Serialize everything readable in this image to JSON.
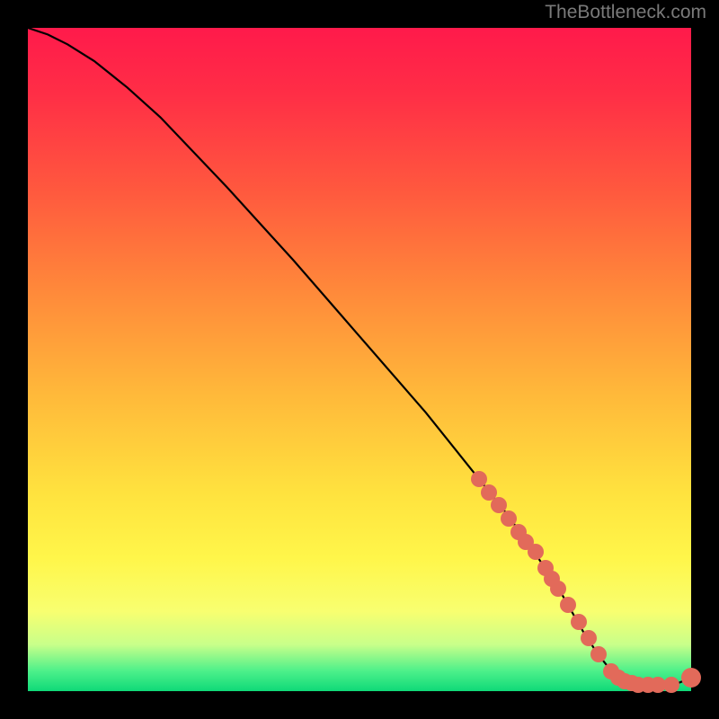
{
  "attribution_text": "TheBottleneck.com",
  "chart_data": {
    "type": "line",
    "xlabel": "",
    "ylabel": "",
    "xlim": [
      0,
      100
    ],
    "ylim": [
      0,
      100
    ],
    "grid": false,
    "legend": false,
    "series": [
      {
        "name": "curve",
        "style": "line",
        "color": "#000000",
        "x": [
          0,
          3,
          6,
          10,
          15,
          20,
          30,
          40,
          50,
          60,
          68,
          72,
          76,
          80,
          82,
          84,
          86,
          88,
          90,
          92,
          94,
          96,
          98,
          100
        ],
        "y": [
          100,
          99,
          97.5,
          95,
          91,
          86.5,
          76,
          65,
          53.5,
          42,
          32,
          27,
          21.5,
          15.5,
          12,
          8.5,
          5.5,
          3,
          1.5,
          1,
          1,
          1,
          1.2,
          2
        ]
      },
      {
        "name": "markers",
        "style": "scatter",
        "color": "#e26a5a",
        "x": [
          68,
          69.5,
          71,
          72.5,
          74,
          75,
          76.5,
          78,
          79,
          80,
          81.5,
          83,
          84.5,
          86,
          88,
          89,
          90,
          91,
          92,
          93.5,
          95,
          97,
          100
        ],
        "y": [
          32,
          30,
          28,
          26,
          24,
          22.5,
          21,
          18.5,
          17,
          15.5,
          13,
          10.5,
          8,
          5.5,
          3,
          2,
          1.5,
          1.2,
          1,
          1,
          1,
          1,
          2
        ]
      }
    ],
    "gradient_stops": [
      {
        "offset": 0.0,
        "color": "#ff1a4b"
      },
      {
        "offset": 0.1,
        "color": "#ff2e46"
      },
      {
        "offset": 0.25,
        "color": "#ff5a3e"
      },
      {
        "offset": 0.4,
        "color": "#ff8a3a"
      },
      {
        "offset": 0.55,
        "color": "#ffb83a"
      },
      {
        "offset": 0.7,
        "color": "#ffe23e"
      },
      {
        "offset": 0.8,
        "color": "#fff64a"
      },
      {
        "offset": 0.88,
        "color": "#f8ff70"
      },
      {
        "offset": 0.93,
        "color": "#c8ff8a"
      },
      {
        "offset": 0.97,
        "color": "#4cf08a"
      },
      {
        "offset": 1.0,
        "color": "#0fd978"
      }
    ]
  }
}
